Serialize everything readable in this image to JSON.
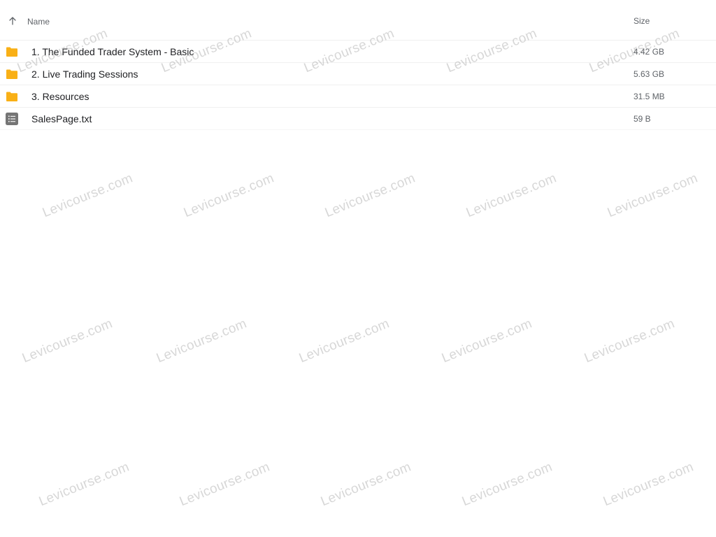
{
  "header": {
    "name_label": "Name",
    "size_label": "Size"
  },
  "icons": {
    "sort": "arrow-up-icon",
    "folder": "folder-icon",
    "text_file": "text-file-icon"
  },
  "colors": {
    "folder": "#F9B016",
    "file_icon": "#757575",
    "text_primary": "#202124",
    "text_secondary": "#5f6368"
  },
  "items": [
    {
      "name": "1. The Funded Trader System - Basic",
      "size": "4.42 GB",
      "type": "folder"
    },
    {
      "name": "2. Live Trading Sessions",
      "size": "5.63 GB",
      "type": "folder"
    },
    {
      "name": "3. Resources",
      "size": "31.5 MB",
      "type": "folder"
    },
    {
      "name": "SalesPage.txt",
      "size": "59 B",
      "type": "file"
    }
  ],
  "watermark": {
    "text": "Levicourse.com"
  }
}
